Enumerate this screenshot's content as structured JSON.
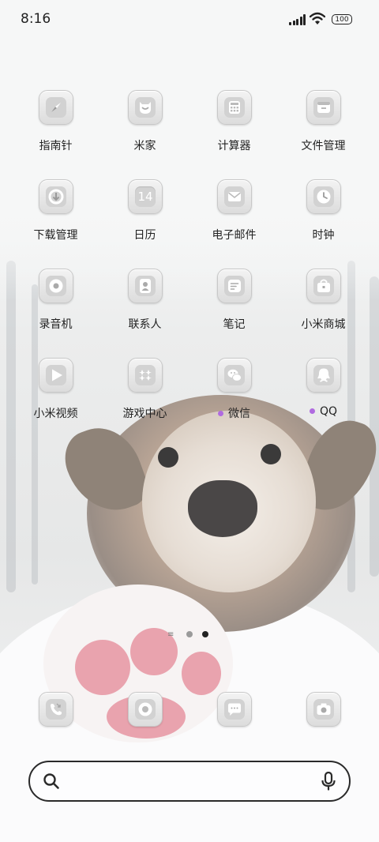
{
  "status_bar": {
    "time": "8:16",
    "battery": "100"
  },
  "apps": [
    {
      "name": "指南针",
      "icon": "compass-icon"
    },
    {
      "name": "米家",
      "icon": "mijia-icon"
    },
    {
      "name": "计算器",
      "icon": "calculator-icon"
    },
    {
      "name": "文件管理",
      "icon": "folder-icon"
    },
    {
      "name": "下载管理",
      "icon": "download-icon"
    },
    {
      "name": "日历",
      "icon": "calendar-icon",
      "badge_text": "14"
    },
    {
      "name": "电子邮件",
      "icon": "mail-icon"
    },
    {
      "name": "时钟",
      "icon": "clock-icon"
    },
    {
      "name": "录音机",
      "icon": "recorder-icon"
    },
    {
      "name": "联系人",
      "icon": "contacts-icon"
    },
    {
      "name": "笔记",
      "icon": "notes-icon"
    },
    {
      "name": "小米商城",
      "icon": "shop-icon"
    },
    {
      "name": "小米视频",
      "icon": "video-icon"
    },
    {
      "name": "游戏中心",
      "icon": "game-center-icon"
    },
    {
      "name": "微信",
      "icon": "wechat-icon",
      "new_dot": true
    },
    {
      "name": "QQ",
      "icon": "qq-icon",
      "new_dot": true
    }
  ],
  "dock": [
    {
      "icon": "phone-icon"
    },
    {
      "icon": "browser-icon"
    },
    {
      "icon": "messages-icon"
    },
    {
      "icon": "camera-icon"
    }
  ],
  "pager": {
    "pages": 3,
    "current": 3
  },
  "colors": {
    "new_dot": "#b06be0",
    "text": "#222222"
  }
}
